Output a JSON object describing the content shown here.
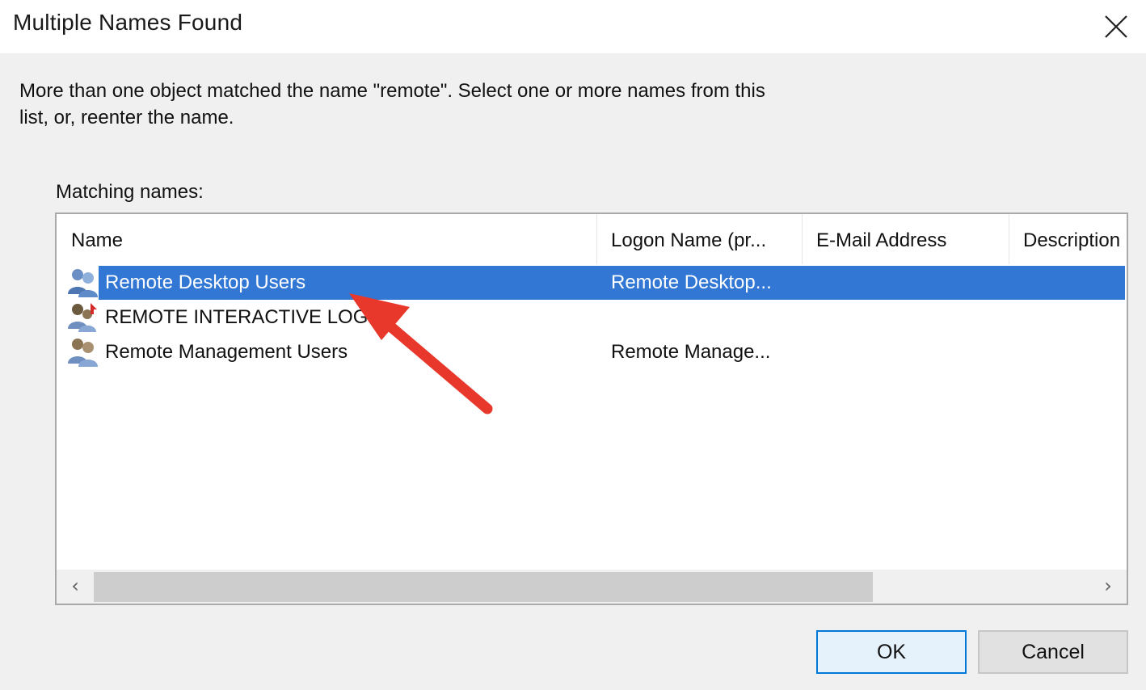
{
  "window": {
    "title": "Multiple Names Found",
    "close_icon": "close-icon"
  },
  "message": "More than one object matched the name \"remote\". Select one or more names from this list, or, reenter the name.",
  "list": {
    "label": "Matching names:",
    "columns": [
      "Name",
      "Logon Name (pr...",
      "E-Mail Address",
      "Description"
    ],
    "rows": [
      {
        "name": "Remote Desktop Users",
        "logon": "Remote Desktop...",
        "email": "",
        "description": "",
        "selected": true,
        "icon": "group-icon"
      },
      {
        "name": "REMOTE INTERACTIVE LOGON",
        "logon": "",
        "email": "",
        "description": "",
        "selected": false,
        "icon": "well-known-group-icon"
      },
      {
        "name": "Remote Management Users",
        "logon": "Remote Manage...",
        "email": "",
        "description": "",
        "selected": false,
        "icon": "group-icon"
      }
    ],
    "scroll_left": "‹",
    "scroll_right": "›"
  },
  "buttons": {
    "ok": "OK",
    "cancel": "Cancel"
  },
  "colors": {
    "selection": "#3177d3",
    "annotation_arrow": "#e8372b",
    "default_button_border": "#0078d7"
  }
}
